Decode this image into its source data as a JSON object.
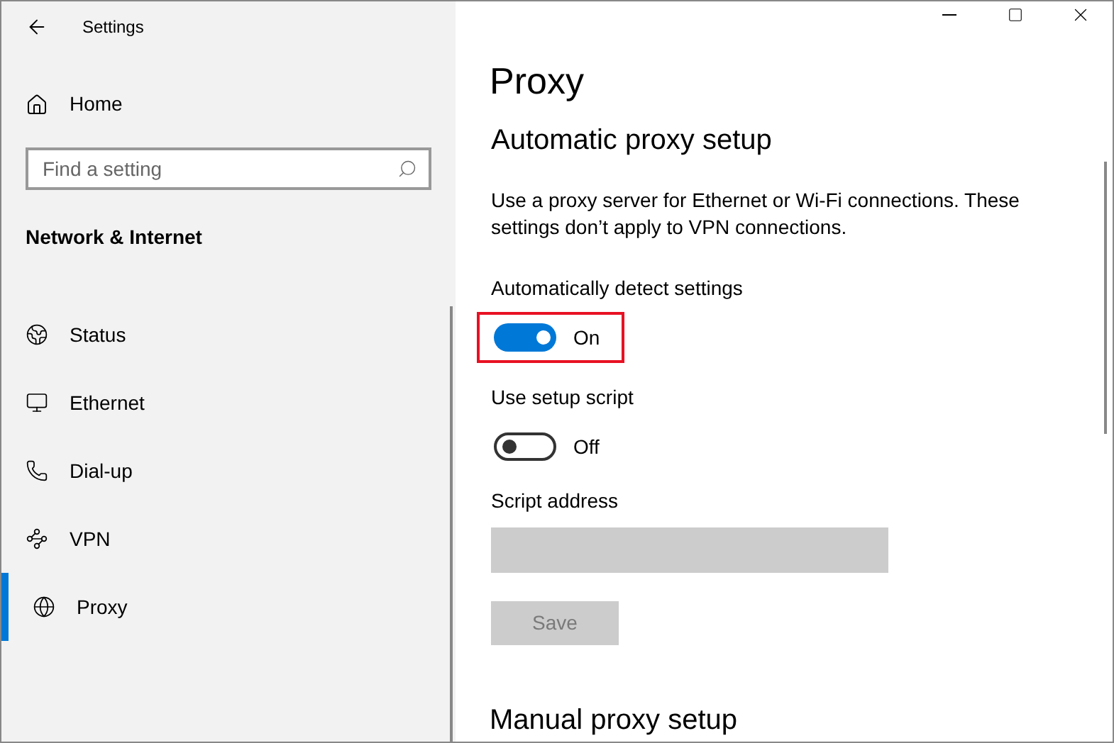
{
  "window": {
    "title": "Settings"
  },
  "sidebar": {
    "home": "Home",
    "search": {
      "placeholder": "Find a setting"
    },
    "section": "Network & Internet",
    "items": [
      {
        "label": "Status",
        "kind": "status",
        "selected": false
      },
      {
        "label": "Ethernet",
        "kind": "ethernet",
        "selected": false
      },
      {
        "label": "Dial-up",
        "kind": "dialup",
        "selected": false
      },
      {
        "label": "VPN",
        "kind": "vpn",
        "selected": false
      },
      {
        "label": "Proxy",
        "kind": "proxy",
        "selected": true
      }
    ]
  },
  "page": {
    "title": "Proxy",
    "automatic": {
      "heading": "Automatic proxy setup",
      "description": "Use a proxy server for Ethernet or Wi-Fi connections. These settings don’t apply to VPN connections.",
      "toggles": [
        {
          "label": "Automatically detect settings",
          "on": true,
          "state_text": "On",
          "highlighted": true
        },
        {
          "label": "Use setup script",
          "on": false,
          "state_text": "Off"
        }
      ],
      "script_address": {
        "label": "Script address",
        "disabled": true
      },
      "save_button": {
        "label": "Save",
        "disabled": true
      }
    },
    "manual": {
      "heading": "Manual proxy setup"
    }
  }
}
